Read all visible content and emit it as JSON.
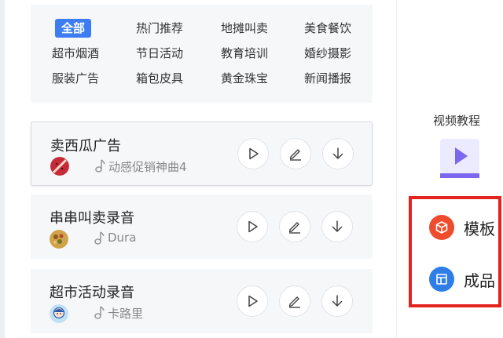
{
  "categories": {
    "rows": [
      [
        "全部",
        "热门推荐",
        "地摊叫卖",
        "美食餐饮"
      ],
      [
        "超市烟酒",
        "节日活动",
        "教育培训",
        "婚纱摄影"
      ],
      [
        "服装广告",
        "箱包皮具",
        "黄金珠宝",
        "新闻播报"
      ]
    ],
    "selected": "全部"
  },
  "audio_list": [
    {
      "title": "卖西瓜广告",
      "music": "动感促销神曲4",
      "avatar": "watermelon",
      "selected": true
    },
    {
      "title": "串串叫卖录音",
      "music": "Dura",
      "avatar": "food",
      "selected": false
    },
    {
      "title": "超市活动录音",
      "music": "卡路里",
      "avatar": "person",
      "selected": false
    }
  ],
  "icons": {
    "play": "play-icon",
    "edit": "edit-icon",
    "download": "download-icon",
    "music": "music-note-icon",
    "video": "video-tutorial-icon",
    "template": "template-icon",
    "product": "product-icon"
  },
  "side_panel": {
    "video_tutorial_label": "视频教程",
    "template_label": "模板",
    "product_label": "成品"
  },
  "colors": {
    "accent_blue": "#3c7ef2",
    "highlight_red": "#e3231e",
    "template_orange": "#ee4c2c",
    "product_blue": "#2f7ee8",
    "video_purple": "#7b68ee"
  }
}
